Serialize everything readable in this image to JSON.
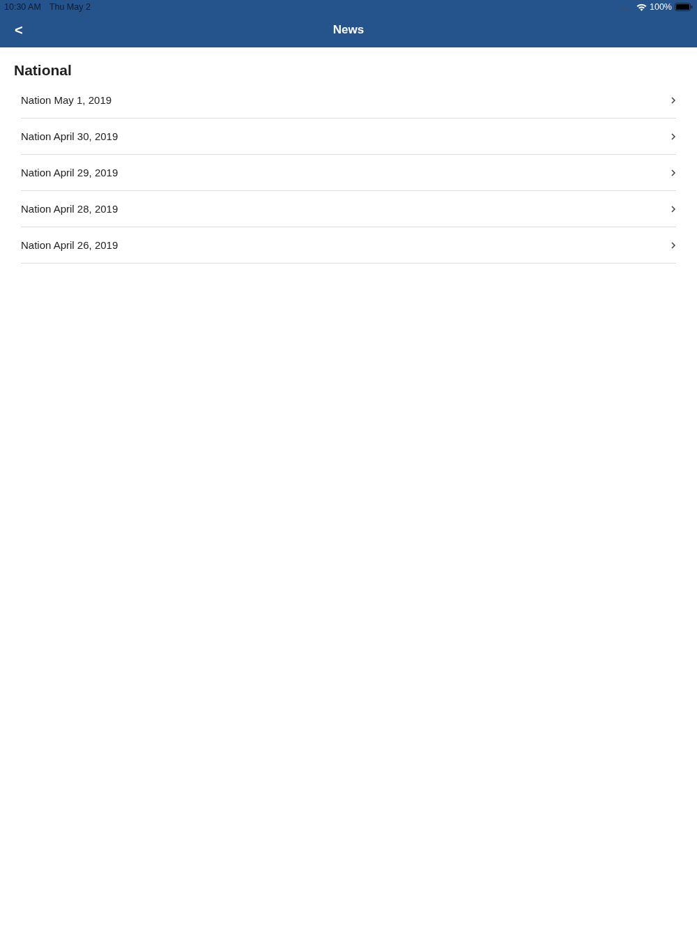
{
  "status_bar": {
    "time": "10:30 AM",
    "date": "Thu May 2",
    "battery": "100%"
  },
  "nav_bar": {
    "back": "<",
    "title": "News"
  },
  "section": {
    "title": "National",
    "items": [
      {
        "label": "Nation May 1, 2019"
      },
      {
        "label": "Nation April 30, 2019"
      },
      {
        "label": "Nation April 29, 2019"
      },
      {
        "label": "Nation April 28, 2019"
      },
      {
        "label": "Nation April 26, 2019"
      }
    ]
  }
}
